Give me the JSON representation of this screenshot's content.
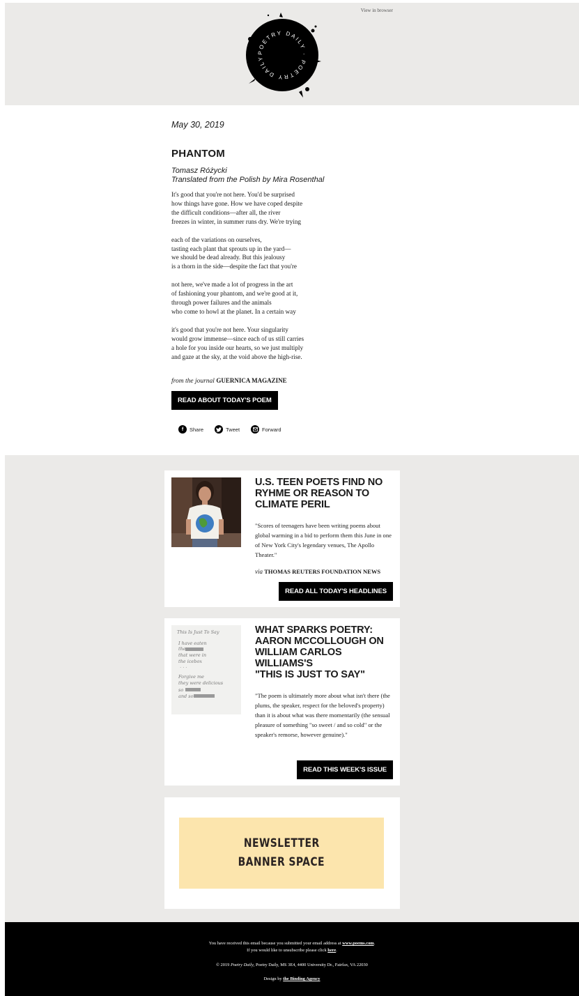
{
  "header": {
    "view_in_browser": "View in browser",
    "logo_text": "POETRY DAILY · POETRY DAILY ·"
  },
  "poem": {
    "date": "May 30, 2019",
    "title": "PHANTOM",
    "author": "Tomasz Różycki",
    "translator": "Translated from the Polish by Mira Rosenthal",
    "stanzas": [
      [
        "It's good that you're not here. You'd be surprised",
        "how things have gone. How we have coped despite",
        "the difficult conditions—after all, the river",
        "freezes in winter, in summer runs dry. We're trying"
      ],
      [
        "each of the variations on ourselves,",
        "tasting each plant that sprouts up in the yard—",
        "we should be dead already. But this jealousy",
        "is a thorn in the side—despite the fact that you're"
      ],
      [
        "not here, we've made a lot of progress in the art",
        "of fashioning your phantom, and we're good at it,",
        "through power failures and the animals",
        "who come to howl at the planet. In a certain way"
      ],
      [
        "it's good that you're not here. Your singularity",
        "would grow immense—since each of us still carries",
        "a hole for you inside our hearts, so we just multiply",
        "and gaze at the sky, at the void above the high-rise."
      ]
    ],
    "source_prefix": "from the journal",
    "source_journal": "GUERNICA MAGAZINE",
    "read_button": "READ ABOUT TODAY'S POEM"
  },
  "share": {
    "share": "Share",
    "tweet": "Tweet",
    "forward": "Forward"
  },
  "cards": [
    {
      "title": "U.S. TEEN POETS FIND NO RYHME OR REASON TO CLIMATE PERIL",
      "body": "\"Scores of teenagers have been writing poems about global warming in a bid to perform them this June in one of New York City's legendary venues, The Apollo Theater.\"",
      "via_prefix": "via",
      "via_source": "THOMAS REUTERS FOUNDATION NEWS",
      "button": "READ ALL TODAY'S HEADLINES"
    },
    {
      "title_lines": [
        "WHAT SPARKS POETRY:",
        "AARON MCCOLLOUGH ON",
        "WILLIAM CARLOS",
        "WILLIAMS'S",
        "\"THIS IS JUST TO SAY\""
      ],
      "body": "\"The poem is ultimately more about what isn't there (the plums, the speaker, respect for the beloved's property) than it is about what was there momentarily (the sensual pleasure of something \"so sweet / and so cold\" or the speaker's remorse, however genuine).\"",
      "button": "READ THIS WEEK'S ISSUE",
      "manuscript": [
        "This Is Just To Say",
        "I have eaten",
        "the",
        "that were in",
        "the icebox",
        "Forgive me",
        "they were delicious",
        "so",
        "and so"
      ]
    }
  ],
  "banner": {
    "line1": "NEWSLETTER",
    "line2": "BANNER SPACE"
  },
  "footer": {
    "line1_prefix": "You have received this email because you submitted your email address at",
    "line1_link": "www.poems.com",
    "line2_prefix": "If you would like to unsubscribe please click",
    "line2_link": "here",
    "copyright_prefix": "© 2019",
    "copyright_name": "Poetry Daily",
    "copyright_rest": ", Poetry Daily, MS 3E4, 4400 University Dr., Fairfax, VA 22030",
    "design_prefix": "Design by",
    "design_link": "the Binding Agency"
  }
}
